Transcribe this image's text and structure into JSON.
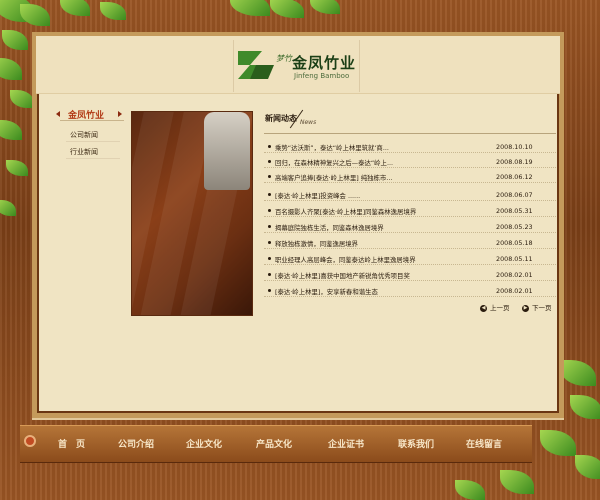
{
  "logo": {
    "cn": "金凤竹业",
    "en": "Jinfeng Bamboo",
    "tag": "梦竹"
  },
  "sidebar": {
    "title": "金凤竹业",
    "items": [
      {
        "label": "公司新闻"
      },
      {
        "label": "行业新闻"
      }
    ]
  },
  "news": {
    "title": "新闻动态",
    "subtitle": "News",
    "rows": [
      {
        "title": "乘势“达沃斯”，泰达“岭上林里筑就‘商...",
        "date": "2008.10.10"
      },
      {
        "title": "回归，在森林精神复兴之后—泰达“岭上...",
        "date": "2008.08.19"
      },
      {
        "title": "高端客户追捧[泰达·岭上林里] 纯独栋市...",
        "date": "2008.06.12"
      },
      {
        "title": "[泰达·岭上林里]投资峰会 ......",
        "date": "2008.06.07"
      },
      {
        "title": "百名摄影人齐聚[泰达·岭上林里]同鉴森林逸居境界",
        "date": "2008.05.31"
      },
      {
        "title": "揭幕庭院独栋生活，同鉴森林逸居境界",
        "date": "2008.05.23"
      },
      {
        "title": "释放独栋激情，同鉴逸居境界",
        "date": "2008.05.18"
      },
      {
        "title": "职业经理人高层峰会，同鉴泰达岭上林里逸居境界",
        "date": "2008.05.11"
      },
      {
        "title": "[泰达·岭上林里]喜获中国地产新锐角优秀项目奖",
        "date": "2008.02.01"
      },
      {
        "title": "[泰达·岭上林里]，安享新春和谐生态",
        "date": "2008.02.01"
      }
    ],
    "prev": "上一页",
    "next": "下一页"
  },
  "nav": {
    "items": [
      {
        "label": "首　页"
      },
      {
        "label": "公司介绍"
      },
      {
        "label": "企业文化"
      },
      {
        "label": "产品文化"
      },
      {
        "label": "企业证书"
      },
      {
        "label": "联系我们"
      },
      {
        "label": "在线留言"
      }
    ]
  },
  "colors": {
    "wood": "#8a4b1f",
    "panel": "#f0e4c3",
    "sidebar_title": "#b23a16",
    "logo_green": "#1b3f16"
  }
}
